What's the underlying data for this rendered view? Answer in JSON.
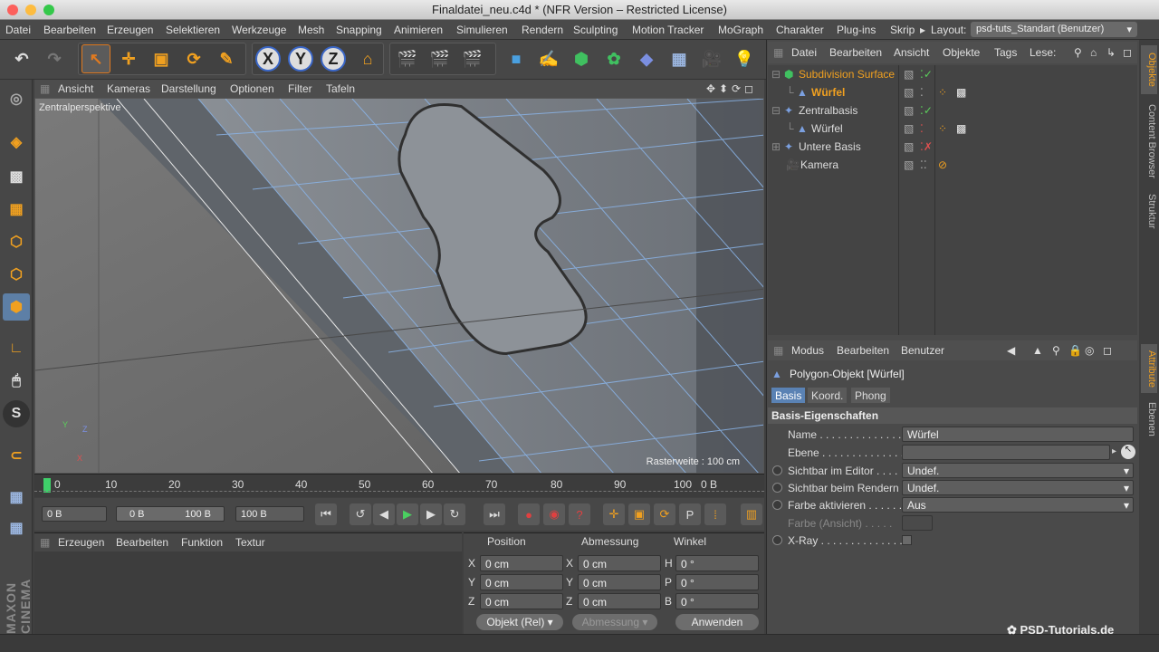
{
  "window": {
    "title": "Finaldatei_neu.c4d * (NFR Version – Restricted License)"
  },
  "menu": {
    "items": [
      "Datei",
      "Bearbeiten",
      "Erzeugen",
      "Selektieren",
      "Werkzeuge",
      "Mesh",
      "Snapping",
      "Animieren",
      "Simulieren",
      "Rendern",
      "Sculpting",
      "Motion Tracker",
      "MoGraph",
      "Charakter",
      "Plug-ins",
      "Skrip"
    ],
    "layout_label": "Layout:",
    "layout_value": "psd-tuts_Standart (Benutzer)"
  },
  "toolbar": {
    "axis_x": "X",
    "axis_y": "Y",
    "axis_z": "Z"
  },
  "viewport": {
    "menu": [
      "Ansicht",
      "Kameras",
      "Darstellung",
      "Optionen",
      "Filter",
      "Tafeln"
    ],
    "label": "Zentralperspektive",
    "raster": "Rasterweite : 100 cm",
    "axis_y": "Y",
    "axis_x": "X",
    "axis_z": "Z"
  },
  "timeline": {
    "ticks": [
      "0",
      "10",
      "20",
      "30",
      "40",
      "50",
      "60",
      "70",
      "80",
      "90",
      "100"
    ],
    "end": "0 B"
  },
  "transport": {
    "current": "0 B",
    "range_start": "0 B",
    "range_end": "100 B",
    "max": "100 B"
  },
  "material": {
    "menu": [
      "Erzeugen",
      "Bearbeiten",
      "Funktion",
      "Textur"
    ]
  },
  "coords": {
    "headers": [
      "Position",
      "Abmessung",
      "Winkel"
    ],
    "rows": [
      {
        "axis": "X",
        "pos": "0 cm",
        "size_axis": "X",
        "size": "0 cm",
        "rot_axis": "H",
        "rot": "0 °"
      },
      {
        "axis": "Y",
        "pos": "0 cm",
        "size_axis": "Y",
        "size": "0 cm",
        "rot_axis": "P",
        "rot": "0 °"
      },
      {
        "axis": "Z",
        "pos": "0 cm",
        "size_axis": "Z",
        "size": "0 cm",
        "rot_axis": "B",
        "rot": "0 °"
      }
    ],
    "mode": "Objekt (Rel)",
    "mode2": "Abmessung",
    "apply": "Anwenden"
  },
  "objects": {
    "menu": [
      "Datei",
      "Bearbeiten",
      "Ansicht",
      "Objekte",
      "Tags",
      "Lese:"
    ],
    "rows": [
      {
        "name": "Subdivision Surface",
        "color": "#f0a020"
      },
      {
        "name": "Würfel",
        "color": "#f0a020"
      },
      {
        "name": "Zentralbasis",
        "color": "#dddddd"
      },
      {
        "name": "Würfel",
        "color": "#dddddd"
      },
      {
        "name": "Untere Basis",
        "color": "#dddddd"
      },
      {
        "name": "Kamera",
        "color": "#dddddd"
      }
    ]
  },
  "attributes": {
    "menu": [
      "Modus",
      "Bearbeiten",
      "Benutzer"
    ],
    "object_title": "Polygon-Objekt [Würfel]",
    "tabs": [
      "Basis",
      "Koord.",
      "Phong"
    ],
    "section": "Basis-Eigenschaften",
    "rows": [
      {
        "label": "Name . . . . . . . . . . . . . . .",
        "value": "Würfel"
      },
      {
        "label": "Ebene . . . . . . . . . . . . . . .",
        "value": ""
      },
      {
        "label": "Sichtbar im Editor . . . .",
        "value": "Undef."
      },
      {
        "label": "Sichtbar beim Rendern",
        "value": "Undef."
      },
      {
        "label": "Farbe aktivieren . . . . . .",
        "value": "Aus"
      },
      {
        "label": "Farbe (Ansicht) . . . . .",
        "value": ""
      },
      {
        "label": "X-Ray . . . . . . . . . . . . . .",
        "value": ""
      }
    ]
  },
  "sidetabs": [
    "Objekte",
    "Content Browser",
    "Struktur",
    "Attribute",
    "Ebenen"
  ],
  "brand": "MAXON CINEMA 4D",
  "watermark": "PSD-Tutorials.de",
  "accent": "#f0a020"
}
